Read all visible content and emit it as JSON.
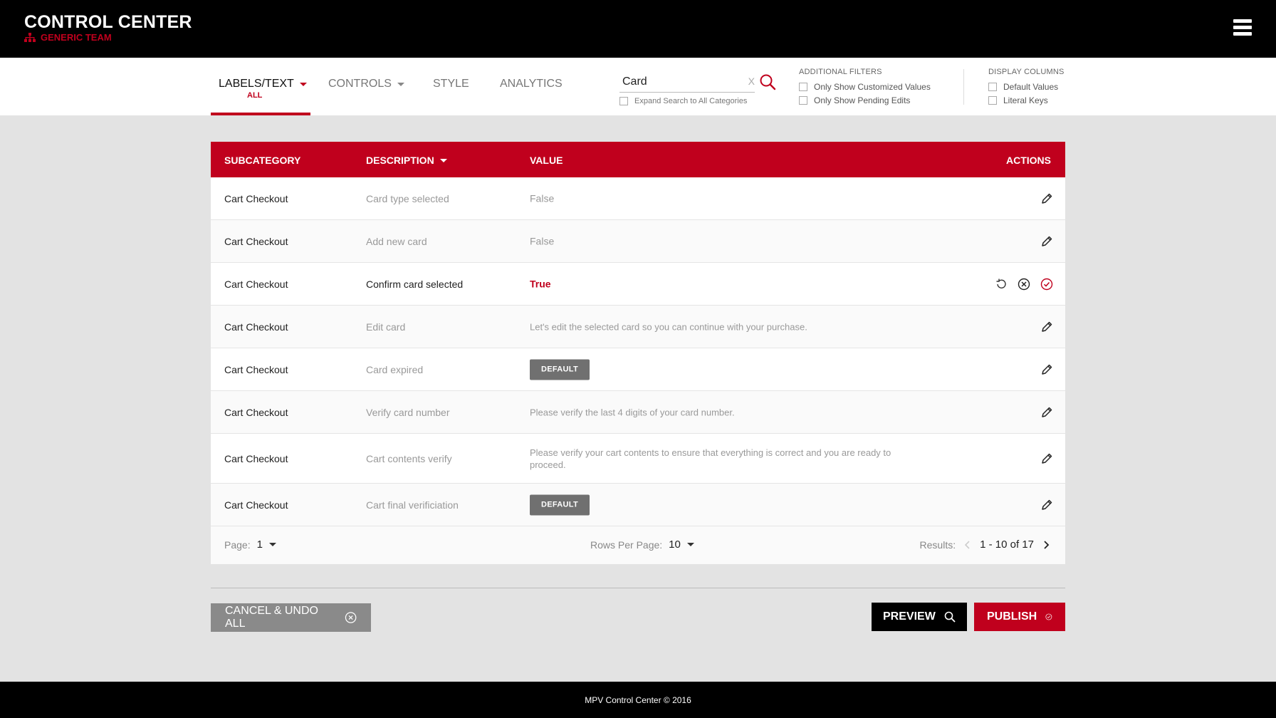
{
  "header": {
    "title": "CONTROL CENTER",
    "team": "GENERIC TEAM",
    "menu_icon": "hamburger-menu-icon"
  },
  "tabs": {
    "labels": {
      "label": "LABELS/TEXT",
      "sub": "ALL"
    },
    "controls": {
      "label": "CONTROLS"
    },
    "style": {
      "label": "STYLE"
    },
    "analytics": {
      "label": "ANALYTICS"
    }
  },
  "search": {
    "value": "Card",
    "clear": "X",
    "expand_label": "Expand Search to All Categories"
  },
  "filters": {
    "heading": "ADDITIONAL FILTERS",
    "customized": "Only Show Customized Values",
    "pending": "Only Show Pending Edits"
  },
  "display_columns": {
    "heading": "DISPLAY COLUMNS",
    "default_values": "Default Values",
    "literal_keys": "Literal Keys"
  },
  "table": {
    "headers": {
      "subcategory": "SUBCATEGORY",
      "description": "DESCRIPTION",
      "value": "VALUE",
      "actions": "ACTIONS"
    },
    "rows": [
      {
        "subcategory": "Cart Checkout",
        "description": "Card type selected",
        "value": "False"
      },
      {
        "subcategory": "Cart Checkout",
        "description": "Add new card",
        "value": "False"
      },
      {
        "subcategory": "Cart Checkout",
        "description": "Confirm card selected",
        "value": "True"
      },
      {
        "subcategory": "Cart Checkout",
        "description": "Edit card",
        "value": "Let's edit the selected card so you can continue with your purchase."
      },
      {
        "subcategory": "Cart Checkout",
        "description": "Card expired",
        "value": "DEFAULT"
      },
      {
        "subcategory": "Cart Checkout",
        "description": "Verify card number",
        "value": "Please verify the last 4 digits of your card number."
      },
      {
        "subcategory": "Cart Checkout",
        "description": "Cart contents verify",
        "value": "Please verify your cart contents to ensure that everything is correct and you are ready to proceed."
      },
      {
        "subcategory": "Cart Checkout",
        "description": "Cart final verificiation",
        "value": "DEFAULT"
      }
    ]
  },
  "pagination": {
    "page_label": "Page:",
    "page_value": "1",
    "rows_label": "Rows Per Page:",
    "rows_value": "10",
    "results_label": "Results:",
    "results_value": "1 - 10 of 17"
  },
  "buttons": {
    "cancel": "CANCEL & UNDO ALL",
    "preview": "PREVIEW",
    "publish": "PUBLISH"
  },
  "footer": {
    "text": "MPV Control Center © 2016"
  },
  "colors": {
    "brand_red": "#c0001d",
    "badge_gray": "#707070",
    "header_black": "#000000"
  }
}
